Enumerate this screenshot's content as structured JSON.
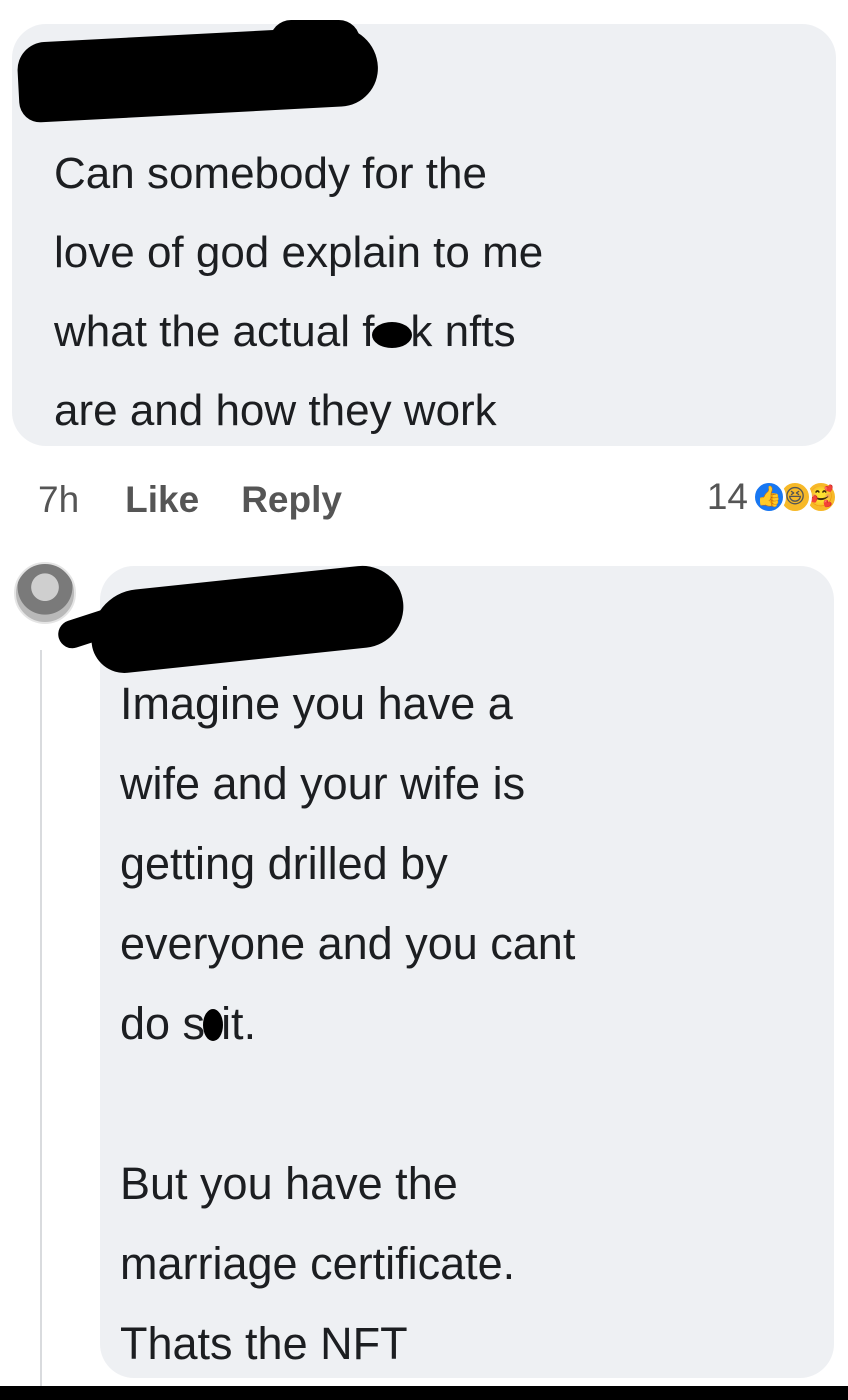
{
  "comment1": {
    "lines": [
      "Can somebody for the",
      "love of god explain to me"
    ],
    "line3_pre": "what the actual f",
    "line3_post": "k nfts",
    "line4": "are and how they work",
    "time": "7h",
    "like_label": "Like",
    "reply_label": "Reply",
    "reaction_count": "14",
    "reaction_icons": [
      "like-icon",
      "haha-icon",
      "care-icon"
    ]
  },
  "comment2": {
    "lines": [
      "Imagine you have a",
      "wife and your wife is",
      "getting drilled by",
      "everyone and you cant"
    ],
    "line5_pre": "do s",
    "line5_post": "it.",
    "para2": [
      "But you have the",
      "marriage certificate.",
      "Thats the NFT"
    ]
  },
  "colors": {
    "bubble": "#eef0f3",
    "text": "#1c1e21",
    "meta": "#555555",
    "like_blue": "#1877f2",
    "emoji_yellow": "#f7b928"
  }
}
